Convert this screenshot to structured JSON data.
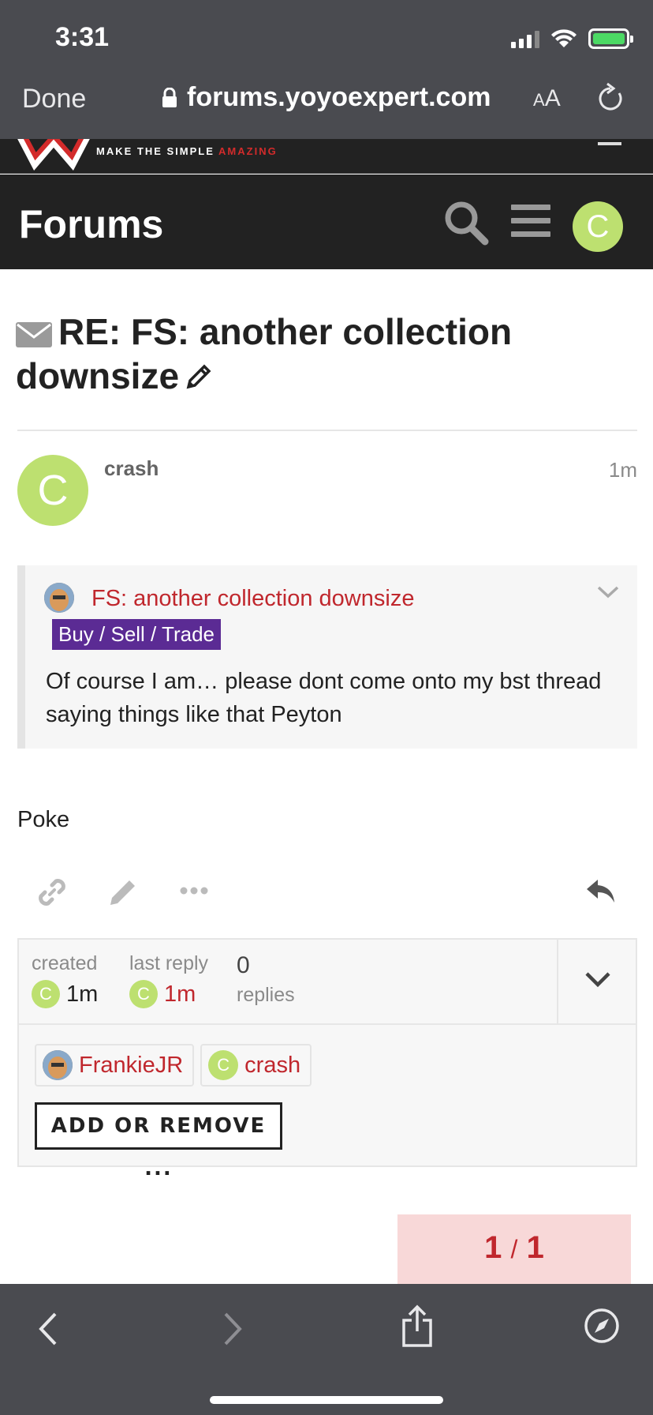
{
  "status_bar": {
    "time": "3:31"
  },
  "browser": {
    "done_label": "Done",
    "url": "forums.yoyoexpert.com",
    "text_size_label_small": "A",
    "text_size_label_large": "A"
  },
  "site": {
    "logo_tagline_prefix": "MAKE THE SIMPLE ",
    "logo_tagline_accent": "AMAZING",
    "forum_title": "Forums",
    "user_avatar_letter": "C"
  },
  "topic": {
    "title_line": "RE: FS: another collection downsize"
  },
  "post": {
    "username": "crash",
    "avatar_letter": "C",
    "time": "1m",
    "quote": {
      "title": "FS: another collection downsize",
      "category": "Buy / Sell / Trade",
      "body": "Of course I am… please dont come onto my bst thread saying things like that Peyton"
    },
    "body": "Poke"
  },
  "topic_map": {
    "created_label": "created",
    "created_value": "1m",
    "created_avatar": "C",
    "last_reply_label": "last reply",
    "last_reply_value": "1m",
    "last_reply_avatar": "C",
    "replies_count": "0",
    "replies_label": "replies",
    "participants": [
      {
        "name": "FrankieJR"
      },
      {
        "name": "crash",
        "avatar_letter": "C"
      }
    ],
    "add_remove_label": "ADD OR REMOVE ..."
  },
  "progress": {
    "current": "1",
    "separator": "/",
    "total": "1"
  },
  "colors": {
    "accent_red": "#c0272d",
    "category_purple": "#5b2b94",
    "avatar_green": "#bde070",
    "header_dark": "#222222",
    "safari_chrome": "#4a4b50"
  }
}
